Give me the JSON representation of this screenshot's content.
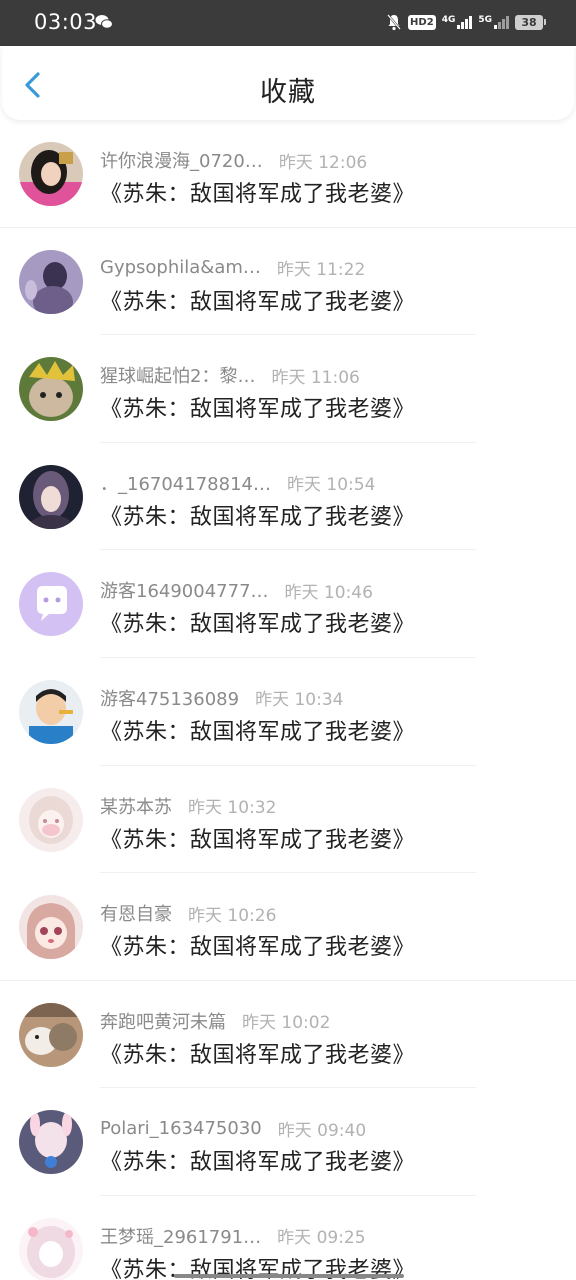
{
  "status": {
    "time": "03:03",
    "hd": "HD2",
    "net1": "4G",
    "net2": "5G",
    "battery": "38"
  },
  "header": {
    "title": "收藏"
  },
  "items": [
    {
      "name": "许你浪漫海_0720…",
      "time": "昨天  12:06",
      "text": "《苏朱：敌国将军成了我老婆》"
    },
    {
      "name": "Gypsophila&am…",
      "time": "昨天  11:22",
      "text": "《苏朱：敌国将军成了我老婆》"
    },
    {
      "name": "猩球崛起怕2：黎…",
      "time": "昨天  11:06",
      "text": "《苏朱：敌国将军成了我老婆》"
    },
    {
      "name": "．_16704178814…",
      "time": "昨天  10:54",
      "text": "《苏朱：敌国将军成了我老婆》"
    },
    {
      "name": "游客1649004777…",
      "time": "昨天  10:46",
      "text": "《苏朱：敌国将军成了我老婆》"
    },
    {
      "name": "游客475136089",
      "time": "昨天  10:34",
      "text": "《苏朱：敌国将军成了我老婆》"
    },
    {
      "name": "某苏本苏",
      "time": "昨天  10:32",
      "text": "《苏朱：敌国将军成了我老婆》"
    },
    {
      "name": "有恩自豪",
      "time": "昨天  10:26",
      "text": "《苏朱：敌国将军成了我老婆》"
    },
    {
      "name": "奔跑吧黄河未篇",
      "time": "昨天  10:02",
      "text": "《苏朱：敌国将军成了我老婆》"
    },
    {
      "name": "Polari_163475030",
      "time": "昨天  09:40",
      "text": "《苏朱：敌国将军成了我老婆》"
    },
    {
      "name": "王梦瑶_2961791…",
      "time": "昨天  09:25",
      "text": "《苏朱：敌国将军成了我老婆》"
    }
  ],
  "colors": {
    "status_bg": "#3b3b3b",
    "back_arrow": "#3a9ad9",
    "name_text": "#8a8a8a",
    "time_text": "#b2b2b2",
    "body_text": "#222222"
  }
}
